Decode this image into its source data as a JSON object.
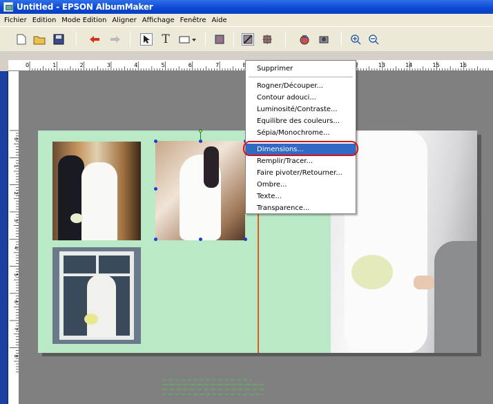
{
  "window": {
    "title": "Untitled - EPSON AlbumMaker"
  },
  "menubar": {
    "items": [
      "Fichier",
      "Edition",
      "Mode Edition",
      "Aligner",
      "Affichage",
      "Fenêtre",
      "Aide"
    ]
  },
  "toolbar": {
    "text_tool": "T"
  },
  "ruler": {
    "labels": [
      "0",
      "1",
      "2",
      "3",
      "4",
      "5",
      "6",
      "7",
      "8",
      "9",
      "10",
      "11",
      "12",
      "13",
      "14",
      "15",
      "16"
    ]
  },
  "context_menu": {
    "items": [
      "Supprimer",
      "Rogner/Découper...",
      "Contour adouci...",
      "Luminosité/Contraste...",
      "Equilibre des couleurs...",
      "Sépia/Monochrome...",
      "Dimensions...",
      "Remplir/Tracer...",
      "Faire pivoter/Retourner...",
      "Ombre...",
      "Texte...",
      "Transparence..."
    ],
    "highlighted": "Dimensions..."
  },
  "colors": {
    "page_bg": "#b9e9c6",
    "highlight": "#316ac5",
    "annotation": "#e01010",
    "spine": "#e05a20"
  }
}
